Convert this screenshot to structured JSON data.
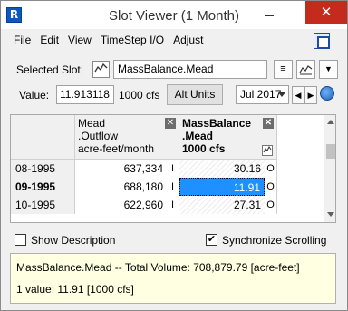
{
  "window": {
    "title": "Slot Viewer (1 Month)",
    "app_icon_glyph": "R",
    "close_glyph": "✕"
  },
  "menu": {
    "items": [
      "File",
      "Edit",
      "View",
      "TimeStep I/O",
      "Adjust"
    ]
  },
  "selected_slot": {
    "label": "Selected Slot:",
    "value": "MassBalance.Mead",
    "type_icon": "chart-slot-icon"
  },
  "toolbar": {
    "list_glyph": "≡",
    "plot_glyph": "⌇",
    "dropdown_glyph": "▼"
  },
  "value_row": {
    "label": "Value:",
    "value": "11.913118",
    "unit": "1000 cfs",
    "alt_units_label": "Alt Units",
    "date": "Jul 2017",
    "prev_glyph": "◀",
    "next_glyph": "▶"
  },
  "table": {
    "columns": [
      {
        "lines": [
          "Mead",
          ".Outflow",
          "acre-feet/month"
        ],
        "close": "✕"
      },
      {
        "lines": [
          "MassBalance",
          ".Mead",
          "1000 cfs"
        ],
        "close": "✕"
      }
    ],
    "rows": [
      {
        "date": "08-1995",
        "bold": false,
        "v1": "637,334",
        "f1": "I",
        "v2": "30.16",
        "f2": "O",
        "selected": false
      },
      {
        "date": "09-1995",
        "bold": true,
        "v1": "688,180",
        "f1": "I",
        "v2": "11.91",
        "f2": "O",
        "selected": true
      },
      {
        "date": "10-1995",
        "bold": false,
        "v1": "622,960",
        "f1": "I",
        "v2": "27.31",
        "f2": "O",
        "selected": false
      }
    ]
  },
  "options": {
    "show_description": {
      "label": "Show Description",
      "checked": false
    },
    "sync_scrolling": {
      "label": "Synchronize Scrolling",
      "checked": true,
      "check_glyph": "✔"
    }
  },
  "info": {
    "line1": "MassBalance.Mead -- Total Volume: 708,879.79 [acre-feet]",
    "line2": "1 value:  11.91 [1000 cfs]"
  }
}
